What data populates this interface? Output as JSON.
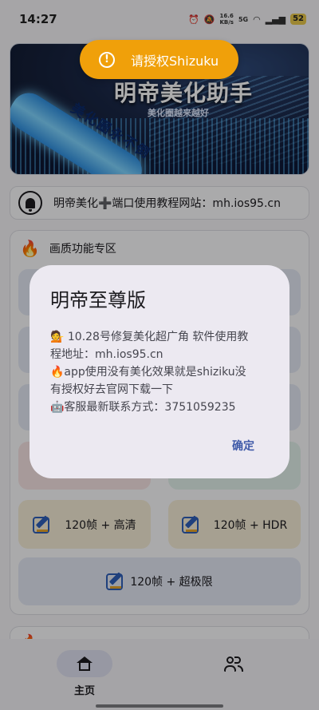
{
  "status_bar": {
    "time": "14:27",
    "net_speed_value": "16.6",
    "net_speed_unit": "KB/s",
    "network": "5G",
    "battery": "52"
  },
  "banner": {
    "title": "明帝美化助手",
    "subtitle": "美化圈越来越好",
    "stick_text": "美化圈永不倒"
  },
  "toast": {
    "text": "请授权Shizuku",
    "icon": "warning-circle-icon"
  },
  "notice": {
    "text": "明帝美化➕端口使用教程网站：mh.ios95.cn",
    "icon": "bell-icon"
  },
  "section": {
    "title": "画质功能专区",
    "icon": "fire-icon",
    "tiles": [
      {
        "label": "120帧 + 高清"
      },
      {
        "label": "120帧 + HDR"
      },
      {
        "label": "120帧 + 超极限"
      }
    ]
  },
  "dialog": {
    "title": "明帝至尊版",
    "lines": [
      "💁 10.28号修复美化超广角 软件使用教",
      "程地址：mh.ios95.cn",
      "🔥app使用没有美化效果就是shiziku没",
      "有授权好去官网下载一下",
      "🤖客服最新联系方式：3751059235"
    ],
    "confirm": "确定"
  },
  "bottom_nav": {
    "items": [
      {
        "label": "主页",
        "icon": "home-icon",
        "active": true
      },
      {
        "label": "",
        "icon": "people-icon",
        "active": false
      }
    ]
  },
  "colors": {
    "toast": "#f0a00a",
    "accent": "#3f5aa8",
    "icon_blue": "#2f5fb8"
  }
}
